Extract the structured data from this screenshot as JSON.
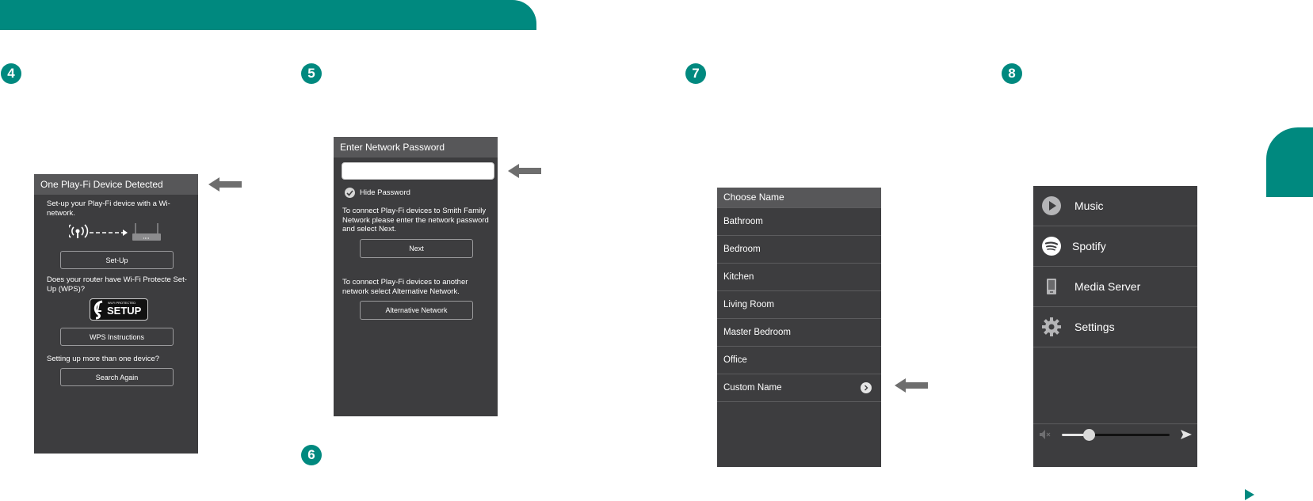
{
  "steps": [
    "4",
    "5",
    "6",
    "7",
    "8"
  ],
  "screen4": {
    "title": "One Play-Fi Device Detected",
    "intro": "Set-up your Play-Fi device with a Wi-network.",
    "setup_button": "Set-Up",
    "wps_question": "Does your router have Wi-Fi Protecte Set-Up (WPS)?",
    "wps_logo_small": "Wi-Fi PROTECTED",
    "wps_logo_big": "SETUP",
    "wps_button": "WPS Instructions",
    "multi_question": "Setting up more than one device?",
    "search_button": "Search Again"
  },
  "screen5": {
    "title": "Enter Network Password",
    "password_value": "",
    "hide_password_label": "Hide Password",
    "instructions": "To connect Play-Fi devices to Smith Family Network please enter the network password and select Next.",
    "next_button": "Next",
    "alt_instructions": "To connect Play-Fi devices to another network select Alternative Network.",
    "alt_button": "Alternative Network"
  },
  "screen7": {
    "title": "Choose Name",
    "names": [
      "Bathroom",
      "Bedroom",
      "Kitchen",
      "Living Room",
      "Master Bedroom",
      "Office",
      "Custom Name"
    ]
  },
  "screen8": {
    "menu": [
      {
        "label": "Music",
        "icon": "play-circle-icon"
      },
      {
        "label": "Spotify",
        "icon": "spotify-icon"
      },
      {
        "label": "Media Server",
        "icon": "media-server-icon"
      },
      {
        "label": "Settings",
        "icon": "gear-icon"
      }
    ],
    "volume": 0.25
  },
  "colors": {
    "accent": "#00897f",
    "panel": "#3d3d3f",
    "header": "#575759",
    "arrow": "#6e6e6e"
  }
}
